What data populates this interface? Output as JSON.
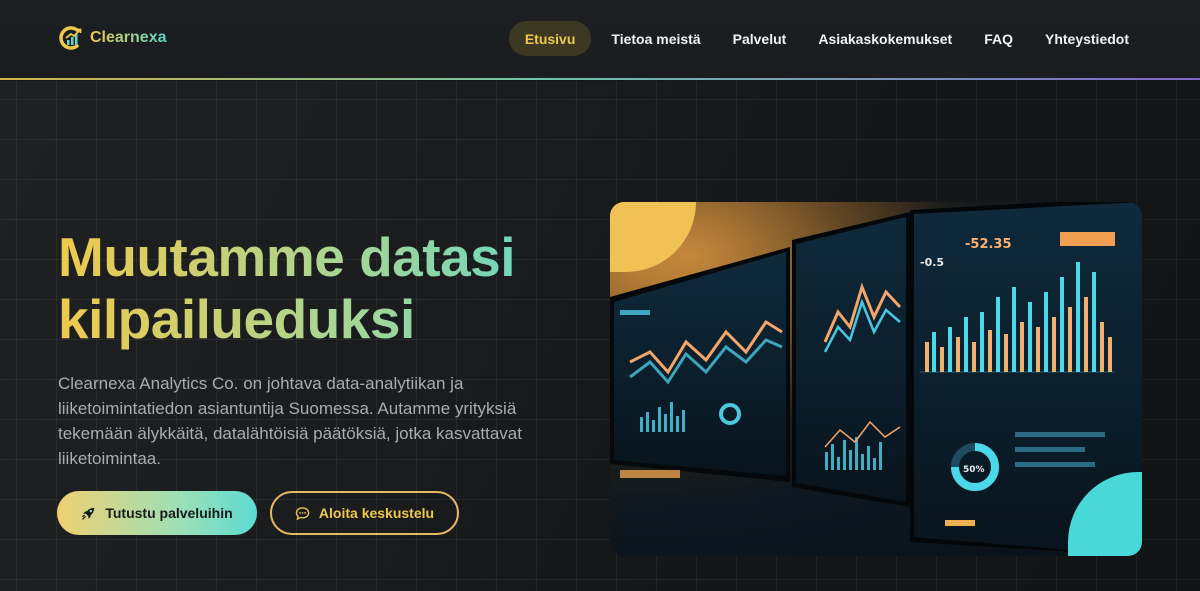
{
  "brand": {
    "name": "Clearnexa",
    "logo_icon": "chart-growth-logo-icon"
  },
  "nav": {
    "items": [
      {
        "label": "Etusivu",
        "active": true
      },
      {
        "label": "Tietoa meistä",
        "active": false
      },
      {
        "label": "Palvelut",
        "active": false
      },
      {
        "label": "Asiakaskokemukset",
        "active": false
      },
      {
        "label": "FAQ",
        "active": false
      },
      {
        "label": "Yhteystiedot",
        "active": false
      }
    ]
  },
  "hero": {
    "headline": "Muutamme datasi kilpailueduksi",
    "lead": "Clearnexa Analytics Co. on johtava data-analytiikan ja liiketoimintatiedon asiantuntija Suomessa. Autamme yrityksiä tekemään älykkäitä, datalähtöisiä päätöksiä, jotka kasvattavat liiketoimintaa.",
    "primary_button": {
      "label": "Tutustu palveluihin",
      "icon": "rocket-icon"
    },
    "secondary_button": {
      "label": "Aloita keskustelu",
      "icon": "chat-bubble-icon"
    },
    "image_alt_text": {
      "gauge_value": "50%",
      "kpi_values": [
        "-0.5",
        "-52.35"
      ]
    }
  },
  "colors": {
    "accent_gold": "#efc94c",
    "accent_teal": "#5fd6c8",
    "background": "#151719",
    "nav_active_bg": "#3d3824"
  }
}
